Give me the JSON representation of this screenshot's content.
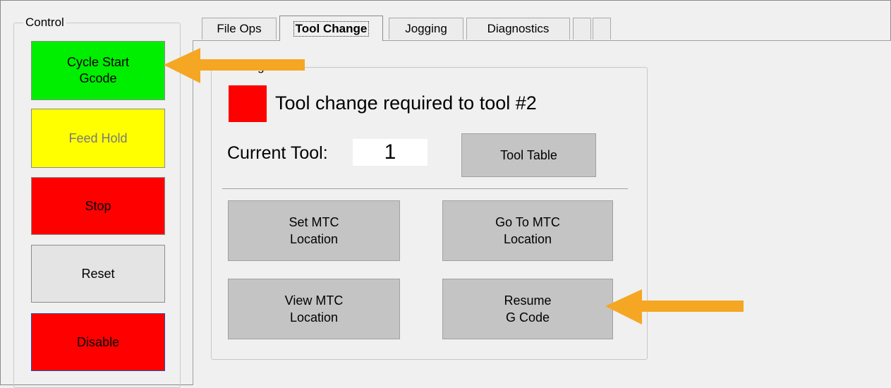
{
  "control": {
    "legend": "Control",
    "buttons": {
      "cycle_start": "Cycle Start\nGcode",
      "feed_hold": "Feed Hold",
      "stop": "Stop",
      "reset": "Reset",
      "disable": "Disable"
    }
  },
  "tabs": [
    {
      "label": "File Ops"
    },
    {
      "label": "Tool Change",
      "active": true
    },
    {
      "label": "Jogging"
    },
    {
      "label": "Diagnostics"
    },
    {
      "label": ""
    },
    {
      "label": ""
    }
  ],
  "tool_change": {
    "legend": "l Change",
    "message": "Tool change required to tool #2",
    "current_tool_label": "Current Tool:",
    "current_tool_value": "1",
    "tool_table_button": "Tool Table",
    "set_mtc_button": "Set MTC\nLocation",
    "goto_mtc_button": "Go To MTC\nLocation",
    "view_mtc_button": "View MTC\nLocation",
    "resume_button": "Resume\nG Code"
  },
  "colors": {
    "cycle_start": "#00ee00",
    "feed_hold": "#ffff00",
    "stop": "#ff0000",
    "disable": "#ff0000",
    "status_indicator": "#ff0000",
    "annotation_arrow": "#f5a623"
  },
  "icons": {
    "annotation_arrows": [
      "arrow-left-icon",
      "arrow-left-icon"
    ]
  }
}
